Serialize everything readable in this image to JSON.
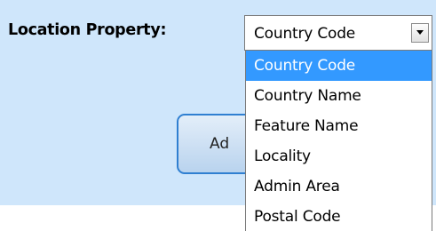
{
  "form": {
    "location_property_label": "Location Property:",
    "selected_value": "Country Code"
  },
  "add_button": {
    "visible_label": "Ad"
  },
  "dropdown": {
    "selected_index": 0,
    "options": [
      "Country Code",
      "Country Name",
      "Feature Name",
      "Locality",
      "Admin Area",
      "Postal Code"
    ]
  },
  "colors": {
    "panel_background": "#cfe6fb",
    "highlight": "#3399ff",
    "button_border": "#2f7fd1"
  },
  "icons": {
    "dropdown_arrow": "chevron-down-icon"
  }
}
